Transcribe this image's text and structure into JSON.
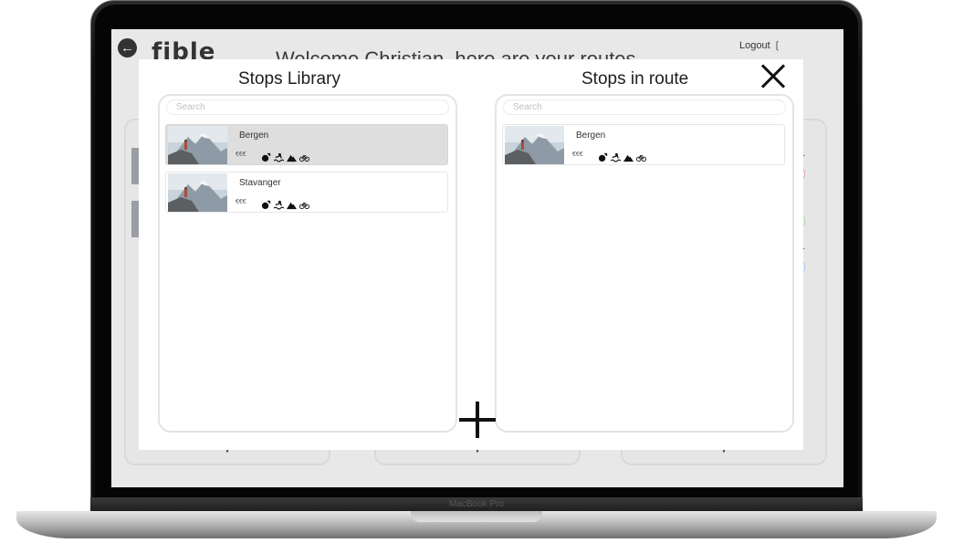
{
  "app": {
    "logo_text": "fible",
    "welcome_text": "Welcome Christian, here are your routes",
    "logout_label": "Logout",
    "logout_icon": "logout-icon",
    "back_icon": "arrow-left-icon"
  },
  "device": {
    "model_label": "MacBook Pro"
  },
  "modal": {
    "close_icon": "close-icon",
    "add_icon": "plus-icon",
    "library": {
      "title": "Stops Library",
      "search_placeholder": "Search",
      "items": [
        {
          "name": "Bergen",
          "price": "€€€",
          "selected": true,
          "icons": [
            "restaurant-icon",
            "swimming-icon",
            "mountain-icon",
            "bicycle-icon"
          ]
        },
        {
          "name": "Stavanger",
          "price": "€€€",
          "selected": false,
          "icons": [
            "restaurant-icon",
            "swimming-icon",
            "mountain-icon",
            "bicycle-icon"
          ]
        }
      ]
    },
    "route": {
      "title": "Stops in route",
      "search_placeholder": "Search",
      "items": [
        {
          "name": "Bergen",
          "price": "€€€",
          "selected": false,
          "icons": [
            "restaurant-icon",
            "swimming-icon",
            "mountain-icon",
            "bicycle-icon"
          ]
        }
      ]
    }
  },
  "colors": {
    "screen_background": "#e8e8e8",
    "modal_background": "#ffffff",
    "selected_card": "#dedede",
    "accent_dark": "#111111"
  }
}
